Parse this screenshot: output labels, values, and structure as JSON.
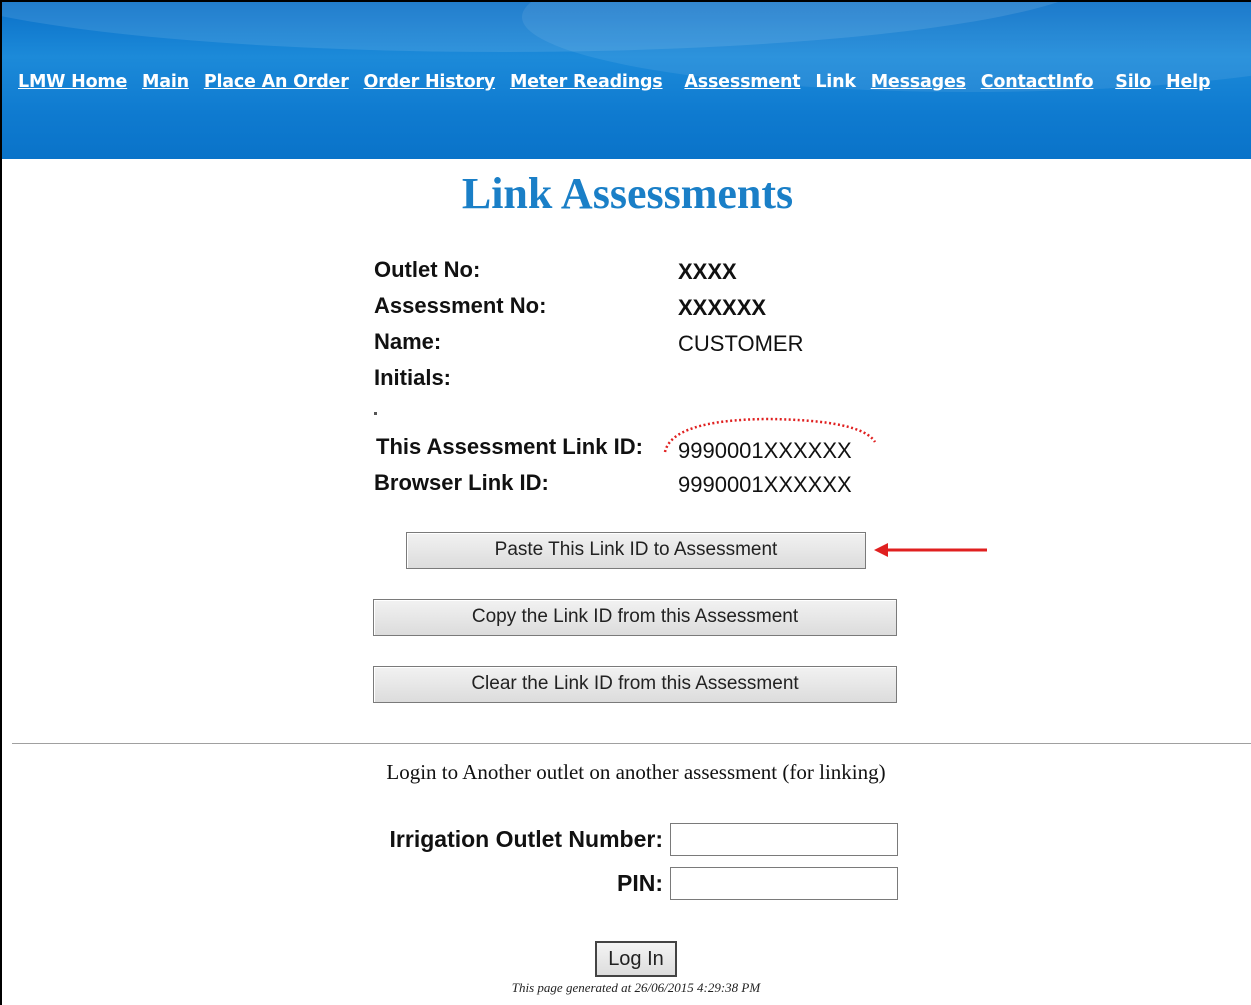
{
  "nav": {
    "items": [
      "LMW Home",
      "Main",
      "Place An Order",
      "Order History",
      "Meter Readings",
      "Assessment"
    ],
    "current": "Link",
    "items_after": [
      "Messages",
      "ContactInfo",
      "Silo",
      "Help"
    ]
  },
  "page_title": "Link Assessments",
  "details": {
    "outlet_no_label": "Outlet No:",
    "outlet_no_value": "XXXX",
    "assessment_no_label": "Assessment No:",
    "assessment_no_value": "XXXXXX",
    "name_label": "Name:",
    "name_value": "CUSTOMER",
    "initials_label": "Initials:",
    "initials_value": "",
    "this_link_label": "This Assessment Link ID:",
    "this_link_value": "9990001XXXXXX",
    "browser_link_label": "Browser Link ID:",
    "browser_link_value": "9990001XXXXXX"
  },
  "buttons": {
    "paste": "Paste This Link ID to Assessment",
    "copy": "Copy the Link ID from this Assessment",
    "clear": "Clear the Link ID from this Assessment"
  },
  "login": {
    "heading": "Login to Another outlet on another assessment (for linking)",
    "outlet_label": "Irrigation Outlet Number:",
    "outlet_value": "",
    "pin_label": "PIN:",
    "pin_value": "",
    "button": "Log In"
  },
  "footer": "This page generated at 26/06/2015 4:29:38 PM",
  "colors": {
    "banner": "#0f7bd0",
    "title": "#1a7fc7",
    "annotation": "#e02020"
  }
}
